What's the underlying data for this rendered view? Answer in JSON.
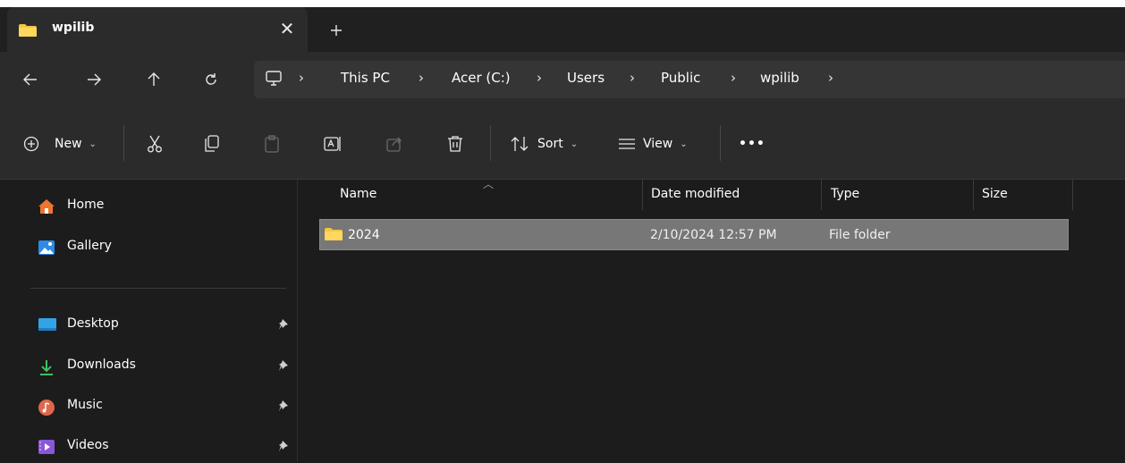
{
  "window": {
    "tab_title": "wpilib",
    "tab_close": "✕",
    "new_tab": "+"
  },
  "address": {
    "breadcrumbs": [
      "This PC",
      "Acer (C:)",
      "Users",
      "Public",
      "wpilib"
    ],
    "separator": "›"
  },
  "commands": {
    "new_label": "New",
    "sort_label": "Sort",
    "view_label": "View",
    "more_label": "•••"
  },
  "sidebar": {
    "items": [
      {
        "label": "Home",
        "icon": "home-icon"
      },
      {
        "label": "Gallery",
        "icon": "gallery-icon"
      },
      {
        "label": "Desktop",
        "icon": "desktop-folder-icon",
        "pinned": true
      },
      {
        "label": "Downloads",
        "icon": "download-icon",
        "pinned": true
      },
      {
        "label": "Music",
        "icon": "music-icon",
        "pinned": true
      },
      {
        "label": "Videos",
        "icon": "videos-icon",
        "pinned": true
      }
    ]
  },
  "filelist": {
    "columns": [
      "Name",
      "Date modified",
      "Type",
      "Size"
    ],
    "rows": [
      {
        "name": "2024",
        "date_modified": "2/10/2024 12:57 PM",
        "type": "File folder",
        "size": ""
      }
    ]
  },
  "colors": {
    "background": "#1c1c1c",
    "toolbar": "#2b2b2b",
    "selection": "#777777",
    "folder": "#f4c542",
    "accent": "#4cc2ff"
  }
}
